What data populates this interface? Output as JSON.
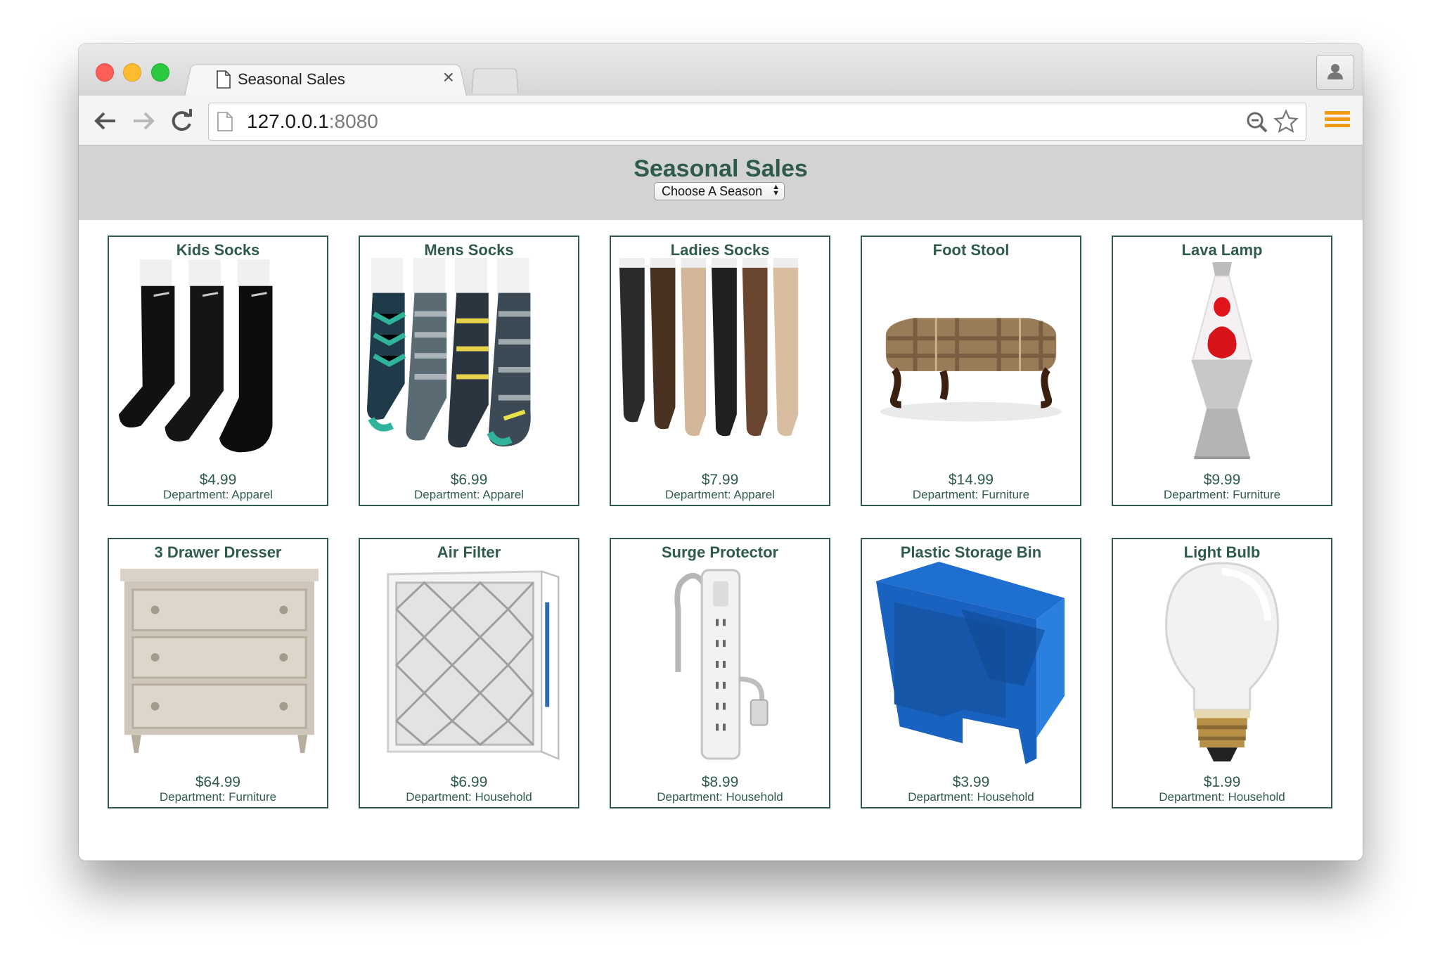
{
  "browser": {
    "tab_title": "Seasonal Sales",
    "tab_close": "×",
    "url_host": "127.0.0.1",
    "url_port": ":8080"
  },
  "page": {
    "title": "Seasonal Sales",
    "season_select": {
      "selected": "Choose A Season"
    }
  },
  "products": [
    {
      "name": "Kids Socks",
      "price": "$4.99",
      "department": "Department: Apparel",
      "icon": "black-socks-image"
    },
    {
      "name": "Mens Socks",
      "price": "$6.99",
      "department": "Department: Apparel",
      "icon": "striped-socks-image"
    },
    {
      "name": "Ladies Socks",
      "price": "$7.99",
      "department": "Department: Apparel",
      "icon": "ladies-socks-image"
    },
    {
      "name": "Foot Stool",
      "price": "$14.99",
      "department": "Department: Furniture",
      "icon": "foot-stool-image"
    },
    {
      "name": "Lava Lamp",
      "price": "$9.99",
      "department": "Department: Furniture",
      "icon": "lava-lamp-image"
    },
    {
      "name": "3 Drawer Dresser",
      "price": "$64.99",
      "department": "Department: Furniture",
      "icon": "dresser-image"
    },
    {
      "name": "Air Filter",
      "price": "$6.99",
      "department": "Department: Household",
      "icon": "air-filter-image"
    },
    {
      "name": "Surge Protector",
      "price": "$8.99",
      "department": "Department: Household",
      "icon": "surge-protector-image"
    },
    {
      "name": "Plastic Storage Bin",
      "price": "$3.99",
      "department": "Department: Household",
      "icon": "storage-bin-image"
    },
    {
      "name": "Light Bulb",
      "price": "$1.99",
      "department": "Department: Household",
      "icon": "light-bulb-image"
    }
  ]
}
